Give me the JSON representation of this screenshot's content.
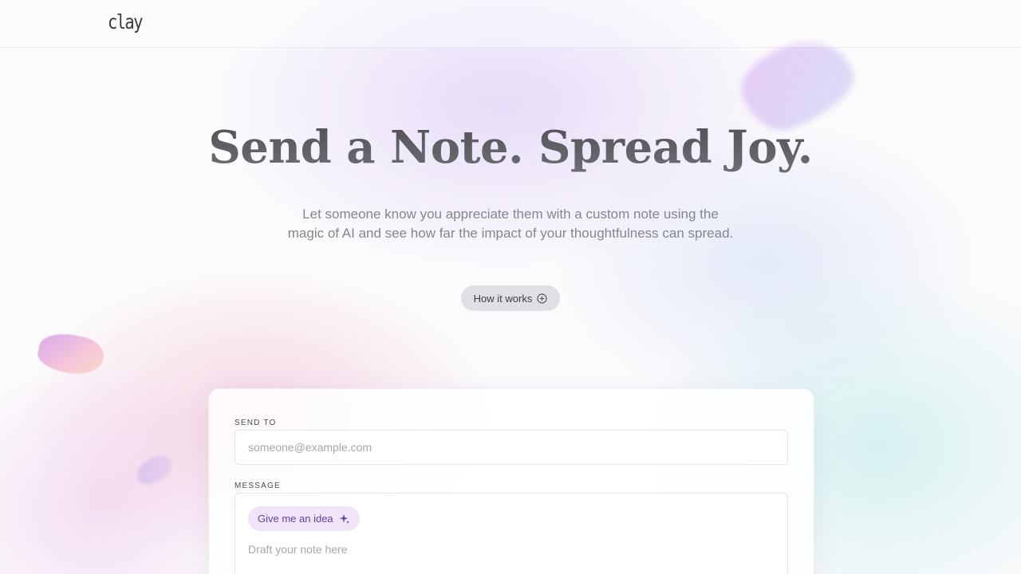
{
  "header": {
    "logo_text": "clay"
  },
  "hero": {
    "title": "Send a Note. Spread Joy.",
    "subtitle": "Let someone know you appreciate them with a custom note using the magic of AI and see how far the impact of your thoughtfulness can spread.",
    "how_it_works_label": "How it works",
    "how_it_works_icon": "plus-circle-icon"
  },
  "form": {
    "send_to_label": "SEND TO",
    "send_to_placeholder": "someone@example.com",
    "send_to_value": "",
    "message_label": "MESSAGE",
    "idea_button_label": "Give me an idea",
    "idea_button_icon": "sparkle-icon",
    "message_placeholder": "Draft your note here",
    "message_value": ""
  },
  "colors": {
    "accent_purple": "#6a3fa0",
    "idea_button_bg": "#efe4f8",
    "text_muted": "#86868c"
  }
}
